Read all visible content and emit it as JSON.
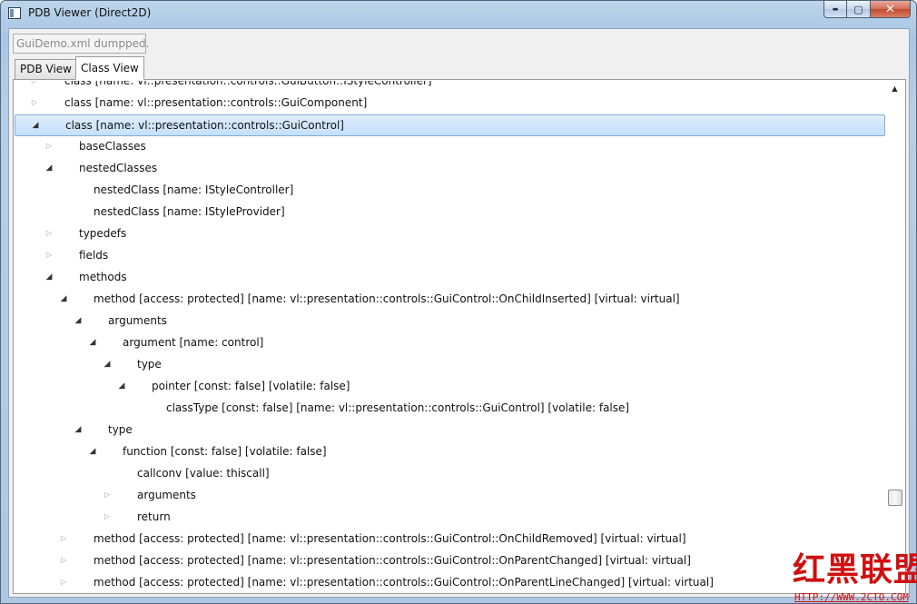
{
  "window": {
    "title": "PDB Viewer (Direct2D)",
    "caption_buttons": {
      "minimize": "▬",
      "maximize": "▢",
      "close": "✕"
    }
  },
  "status_box": {
    "text": "GuiDemo.xml dumpped."
  },
  "tabs": [
    {
      "label": "PDB View",
      "selected": false
    },
    {
      "label": "Class View",
      "selected": true
    }
  ],
  "tree": {
    "rows": [
      {
        "label": "class [name: vl::presentation::controls::GuiButton::IStyleController]",
        "state": "collapsed",
        "depth": 1
      },
      {
        "label": "class [name: vl::presentation::controls::GuiComponent]",
        "state": "collapsed",
        "depth": 1
      },
      {
        "label": "class [name: vl::presentation::controls::GuiControl]",
        "state": "expanded",
        "depth": 1,
        "selected": true
      },
      {
        "label": "baseClasses",
        "state": "collapsed",
        "depth": 2
      },
      {
        "label": "nestedClasses",
        "state": "expanded",
        "depth": 2
      },
      {
        "label": "nestedClass [name: IStyleController]",
        "state": "leaf",
        "depth": 3
      },
      {
        "label": "nestedClass [name: IStyleProvider]",
        "state": "leaf",
        "depth": 3
      },
      {
        "label": "typedefs",
        "state": "collapsed",
        "depth": 2
      },
      {
        "label": "fields",
        "state": "collapsed",
        "depth": 2
      },
      {
        "label": "methods",
        "state": "expanded",
        "depth": 2
      },
      {
        "label": "method [access: protected] [name: vl::presentation::controls::GuiControl::OnChildInserted] [virtual: virtual]",
        "state": "expanded",
        "depth": 3
      },
      {
        "label": "arguments",
        "state": "expanded",
        "depth": 4
      },
      {
        "label": "argument [name: control]",
        "state": "expanded",
        "depth": 5
      },
      {
        "label": "type",
        "state": "expanded",
        "depth": 6
      },
      {
        "label": "pointer [const: false] [volatile: false]",
        "state": "expanded",
        "depth": 7
      },
      {
        "label": "classType [const: false] [name: vl::presentation::controls::GuiControl] [volatile: false]",
        "state": "leaf",
        "depth": 8
      },
      {
        "label": "type",
        "state": "expanded",
        "depth": 4
      },
      {
        "label": "function [const: false] [volatile: false]",
        "state": "expanded",
        "depth": 5
      },
      {
        "label": "callconv [value: thiscall]",
        "state": "leaf",
        "depth": 6
      },
      {
        "label": "arguments",
        "state": "collapsed",
        "depth": 6
      },
      {
        "label": "return",
        "state": "collapsed",
        "depth": 6
      },
      {
        "label": "method [access: protected] [name: vl::presentation::controls::GuiControl::OnChildRemoved] [virtual: virtual]",
        "state": "collapsed",
        "depth": 3
      },
      {
        "label": "method [access: protected] [name: vl::presentation::controls::GuiControl::OnParentChanged] [virtual: virtual]",
        "state": "collapsed",
        "depth": 3
      },
      {
        "label": "method [access: protected] [name: vl::presentation::controls::GuiControl::OnParentLineChanged] [virtual: virtual]",
        "state": "collapsed",
        "depth": 3
      }
    ]
  },
  "scrollbar": {
    "up_arrow": "▲",
    "position_fraction": 0.82
  },
  "watermark": {
    "logo_text": "红黑联盟",
    "url_text": "HTTP://WWW.2CTO.COM"
  }
}
